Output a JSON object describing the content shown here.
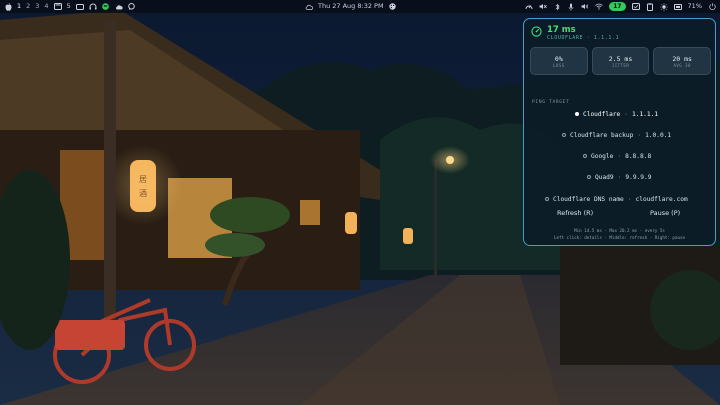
{
  "topbar": {
    "workspaces": [
      "1",
      "2",
      "3",
      "4"
    ],
    "active_workspace": "1",
    "window_count": "5",
    "datetime": "Thu 27 Aug 8:32 PM",
    "ping_badge": "17",
    "battery_percent": "71%",
    "battery_level": 0.71
  },
  "popup": {
    "latency": "17 ms",
    "provider": "CLOUDFLARE · 1.1.1.1",
    "stats": [
      {
        "value": "0%",
        "label": "LOSS"
      },
      {
        "value": "2.5 ms",
        "label": "JITTER"
      },
      {
        "value": "20 ms",
        "label": "AVG 30"
      }
    ],
    "section_label": "PING TARGET",
    "targets": [
      {
        "name": "Cloudflare",
        "ip": "1.1.1.1",
        "selected": true
      },
      {
        "name": "Cloudflare backup",
        "ip": "1.0.0.1",
        "selected": false
      },
      {
        "name": "Google",
        "ip": "8.8.8.8",
        "selected": false
      },
      {
        "name": "Quad9",
        "ip": "9.9.9.9",
        "selected": false
      },
      {
        "name": "Cloudflare DNS name",
        "ip": "cloudflare.com",
        "selected": false
      }
    ],
    "refresh_label": "Refresh  (R)",
    "pause_label": "Pause  (P)",
    "footer_line1": "Min 14.5 ms  ·  Max 20.2 ms  ·  every 5s",
    "footer_line2": "Left click: details  ·  Middle: refresh  ·  Right: pause"
  },
  "lantern_text": "居酒"
}
